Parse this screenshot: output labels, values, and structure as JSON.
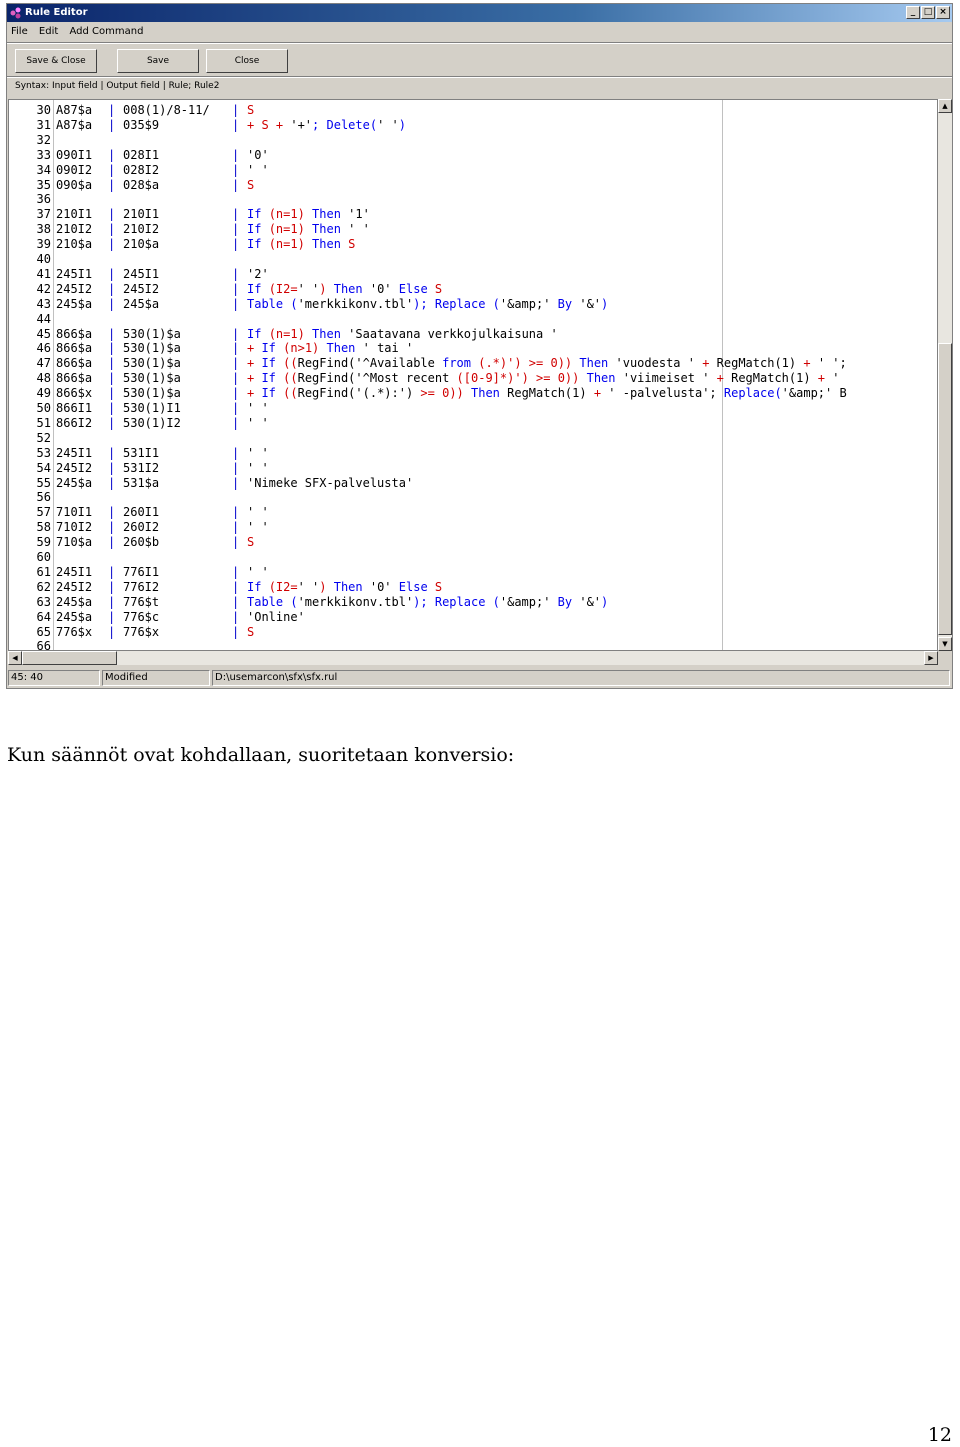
{
  "window": {
    "title": "Rule Editor",
    "controls": {
      "minimize": "_",
      "maximize": "□",
      "close": "×"
    }
  },
  "menu": [
    "File",
    "Edit",
    "Add Command"
  ],
  "toolbar": {
    "save_close": "Save & Close",
    "save": "Save",
    "close": "Close"
  },
  "syntax_hint": "Syntax: Input field | Output field | Rule; Rule2",
  "lines": [
    {
      "n": "30",
      "in": "A87$a",
      "out": "008(1)/8-11/",
      "rule": [
        [
          "op",
          "S"
        ]
      ]
    },
    {
      "n": "31",
      "in": "A87$a",
      "out": "035$9",
      "rule": [
        [
          "op",
          "+ S + "
        ],
        [
          "st",
          "'+'"
        ],
        [
          "kw",
          "; Delete("
        ],
        [
          "st",
          "' '"
        ],
        [
          "kw",
          ")"
        ]
      ]
    },
    {
      "n": "32",
      "in": "",
      "out": "",
      "rule": []
    },
    {
      "n": "33",
      "in": "090I1",
      "out": "028I1",
      "rule": [
        [
          "st",
          "'0'"
        ]
      ]
    },
    {
      "n": "34",
      "in": "090I2",
      "out": "028I2",
      "rule": [
        [
          "st",
          "' '"
        ]
      ]
    },
    {
      "n": "35",
      "in": "090$a",
      "out": "028$a",
      "rule": [
        [
          "op",
          "S"
        ]
      ]
    },
    {
      "n": "36",
      "in": "",
      "out": "",
      "rule": []
    },
    {
      "n": "37",
      "in": "210I1",
      "out": "210I1",
      "rule": [
        [
          "kw",
          "If "
        ],
        [
          "op",
          "(n=1) "
        ],
        [
          "kw",
          "Then "
        ],
        [
          "st",
          "'1'"
        ]
      ]
    },
    {
      "n": "38",
      "in": "210I2",
      "out": "210I2",
      "rule": [
        [
          "kw",
          "If "
        ],
        [
          "op",
          "(n=1) "
        ],
        [
          "kw",
          "Then "
        ],
        [
          "st",
          "' '"
        ]
      ]
    },
    {
      "n": "39",
      "in": "210$a",
      "out": "210$a",
      "rule": [
        [
          "kw",
          "If "
        ],
        [
          "op",
          "(n=1) "
        ],
        [
          "kw",
          "Then "
        ],
        [
          "op",
          "S"
        ]
      ]
    },
    {
      "n": "40",
      "in": "",
      "out": "",
      "rule": []
    },
    {
      "n": "41",
      "in": "245I1",
      "out": "245I1",
      "rule": [
        [
          "st",
          "'2'"
        ]
      ]
    },
    {
      "n": "42",
      "in": "245I2",
      "out": "245I2",
      "rule": [
        [
          "kw",
          "If "
        ],
        [
          "op",
          "(I2="
        ],
        [
          "st",
          "' '"
        ],
        [
          "op",
          ") "
        ],
        [
          "kw",
          "Then "
        ],
        [
          "st",
          "'0' "
        ],
        [
          "kw",
          "Else "
        ],
        [
          "op",
          "S"
        ]
      ]
    },
    {
      "n": "43",
      "in": "245$a",
      "out": "245$a",
      "rule": [
        [
          "kw",
          "Table ("
        ],
        [
          "st",
          "'merkkikonv.tbl'"
        ],
        [
          "kw",
          "); Replace ("
        ],
        [
          "st",
          "'&amp;'"
        ],
        [
          "kw",
          " By "
        ],
        [
          "st",
          "'&'"
        ],
        [
          "kw",
          ")"
        ]
      ]
    },
    {
      "n": "44",
      "in": "",
      "out": "",
      "rule": []
    },
    {
      "n": "45",
      "in": "866$a",
      "out": "530(1)$a",
      "rule": [
        [
          "kw",
          "If "
        ],
        [
          "op",
          "(n=1) "
        ],
        [
          "kw",
          "Then "
        ],
        [
          "st",
          "'Saatavana verkkojulkaisuna '"
        ]
      ]
    },
    {
      "n": "46",
      "in": "866$a",
      "out": "530(1)$a",
      "rule": [
        [
          "op",
          "+ "
        ],
        [
          "kw",
          "If "
        ],
        [
          "op",
          "(n>1) "
        ],
        [
          "kw",
          "Then "
        ],
        [
          "st",
          "' tai '"
        ]
      ]
    },
    {
      "n": "47",
      "in": "866$a",
      "out": "530(1)$a",
      "rule": [
        [
          "op",
          "+ "
        ],
        [
          "kw",
          "If "
        ],
        [
          "op",
          "(("
        ],
        [
          "st",
          "RegFind('^Available "
        ],
        [
          "kw",
          "from "
        ],
        [
          "op",
          "(.*)') >= 0)) "
        ],
        [
          "kw",
          "Then "
        ],
        [
          "st",
          "'vuodesta ' "
        ],
        [
          "op",
          "+ "
        ],
        [
          "st",
          "RegMatch(1) "
        ],
        [
          "op",
          "+ "
        ],
        [
          "st",
          "' ';"
        ]
      ]
    },
    {
      "n": "48",
      "in": "866$a",
      "out": "530(1)$a",
      "rule": [
        [
          "op",
          "+ "
        ],
        [
          "kw",
          "If "
        ],
        [
          "op",
          "(("
        ],
        [
          "st",
          "RegFind('^Most recent "
        ],
        [
          "op",
          "([0-9]*)') >= 0)) "
        ],
        [
          "kw",
          "Then "
        ],
        [
          "st",
          "'viimeiset ' "
        ],
        [
          "op",
          "+ "
        ],
        [
          "st",
          "RegMatch(1) "
        ],
        [
          "op",
          "+ "
        ],
        [
          "st",
          "'"
        ]
      ]
    },
    {
      "n": "49",
      "in": "866$x",
      "out": "530(1)$a",
      "rule": [
        [
          "op",
          "+ "
        ],
        [
          "kw",
          "If "
        ],
        [
          "op",
          "(("
        ],
        [
          "st",
          "RegFind('(.*):') "
        ],
        [
          "op",
          ">= 0)) "
        ],
        [
          "kw",
          "Then "
        ],
        [
          "st",
          "RegMatch(1) "
        ],
        [
          "op",
          "+ "
        ],
        [
          "st",
          "' -palvelusta'; "
        ],
        [
          "kw",
          "Replace("
        ],
        [
          "st",
          "'&amp;' B"
        ]
      ]
    },
    {
      "n": "50",
      "in": "866I1",
      "out": "530(1)I1",
      "rule": [
        [
          "st",
          "' '"
        ]
      ]
    },
    {
      "n": "51",
      "in": "866I2",
      "out": "530(1)I2",
      "rule": [
        [
          "st",
          "' '"
        ]
      ]
    },
    {
      "n": "52",
      "in": "",
      "out": "",
      "rule": []
    },
    {
      "n": "53",
      "in": "245I1",
      "out": "531I1",
      "rule": [
        [
          "st",
          "' '"
        ]
      ]
    },
    {
      "n": "54",
      "in": "245I2",
      "out": "531I2",
      "rule": [
        [
          "st",
          "' '"
        ]
      ]
    },
    {
      "n": "55",
      "in": "245$a",
      "out": "531$a",
      "rule": [
        [
          "st",
          "'Nimeke SFX-palvelusta'"
        ]
      ]
    },
    {
      "n": "56",
      "in": "",
      "out": "",
      "rule": []
    },
    {
      "n": "57",
      "in": "710I1",
      "out": "260I1",
      "rule": [
        [
          "st",
          "' '"
        ]
      ]
    },
    {
      "n": "58",
      "in": "710I2",
      "out": "260I2",
      "rule": [
        [
          "st",
          "' '"
        ]
      ]
    },
    {
      "n": "59",
      "in": "710$a",
      "out": "260$b",
      "rule": [
        [
          "op",
          "S"
        ]
      ]
    },
    {
      "n": "60",
      "in": "",
      "out": "",
      "rule": []
    },
    {
      "n": "61",
      "in": "245I1",
      "out": "776I1",
      "rule": [
        [
          "st",
          "' '"
        ]
      ]
    },
    {
      "n": "62",
      "in": "245I2",
      "out": "776I2",
      "rule": [
        [
          "kw",
          "If "
        ],
        [
          "op",
          "(I2="
        ],
        [
          "st",
          "' '"
        ],
        [
          "op",
          ") "
        ],
        [
          "kw",
          "Then "
        ],
        [
          "st",
          "'0' "
        ],
        [
          "kw",
          "Else "
        ],
        [
          "op",
          "S"
        ]
      ]
    },
    {
      "n": "63",
      "in": "245$a",
      "out": "776$t",
      "rule": [
        [
          "kw",
          "Table ("
        ],
        [
          "st",
          "'merkkikonv.tbl'"
        ],
        [
          "kw",
          "); Replace ("
        ],
        [
          "st",
          "'&amp;'"
        ],
        [
          "kw",
          " By "
        ],
        [
          "st",
          "'&'"
        ],
        [
          "kw",
          ")"
        ]
      ]
    },
    {
      "n": "64",
      "in": "245$a",
      "out": "776$c",
      "rule": [
        [
          "st",
          "'Online'"
        ]
      ]
    },
    {
      "n": "65",
      "in": "776$x",
      "out": "776$x",
      "rule": [
        [
          "op",
          "S"
        ]
      ]
    },
    {
      "n": "66",
      "in": "",
      "out": "",
      "rule": []
    }
  ],
  "status": {
    "position": "45: 40",
    "state": "Modified",
    "path": "D:\\usemarcon\\sfx\\sfx.rul"
  },
  "caption": "Kun säännöt ovat kohdallaan, suoritetaan konversio:",
  "page_number": "12",
  "colors": {
    "keyword": "#0000ee",
    "operator": "#d00000",
    "string": "#000000",
    "title_start": "#0a246a"
  }
}
